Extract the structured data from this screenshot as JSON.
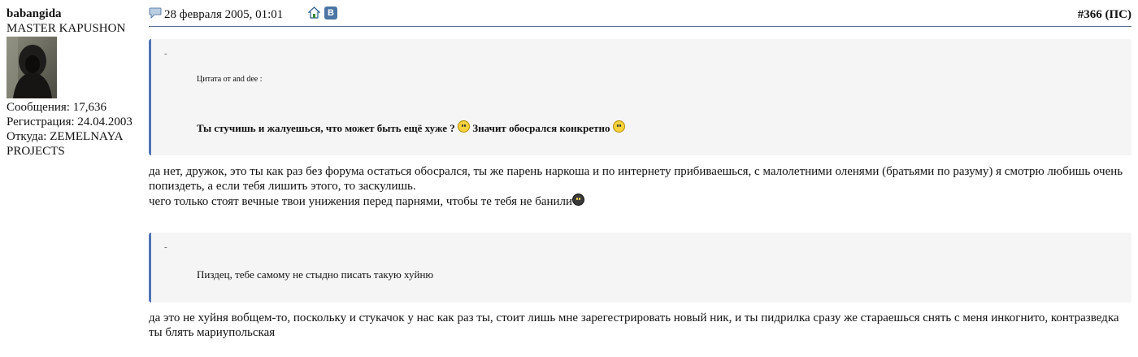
{
  "user": {
    "name": "babangida",
    "rank": "MASTER KAPUSHON",
    "messages": "Сообщения: 17,636",
    "registered": "Регистрация: 24.04.2003",
    "location": "Откуда: ZEMELNAYA PROJECTS"
  },
  "post": {
    "date": "28 февраля 2005, 01:01",
    "vk_label": "В",
    "number": "#366 (ПС)",
    "quote1": {
      "dash": "-",
      "author": "Цитата от and dee :",
      "text_a": "Ты стучишь и жалуешься, что может быть ещё хуже ?",
      "text_b": "Значит обосрался конкретно"
    },
    "reply1_line1": "да нет, дружок, это ты как раз без форума остаться обосрался, ты же парень наркоша и по интернету прибиваешься, с малолетними оленями (братьями по разуму) я смотрю любишь очень попиздеть, а если тебя лишить этого, то заскулишь.",
    "reply1_line2": "чего только стоят вечные твои унижения перед парнями, чтобы те тебя не банили",
    "quote2": {
      "dash": "-",
      "text": "Пиздец, тебе самому не стыдно писать такую хуйню"
    },
    "reply2": "да это не хуйня вобщем-то, поскольку и стукачок у нас как раз ты, стоит лишь мне зарегестрировать новый ник, и ты пидрилка сразу же стараешься снять с меня инкогнито, контразведка ты блять мариупольская"
  },
  "icons": {
    "post_icon": "speech-bubble-icon",
    "home": "home-icon",
    "vk": "vk-icon",
    "smiles": [
      "scared-smiley-icon",
      "grin-smiley-icon",
      "cool-smiley-icon"
    ]
  },
  "colors": {
    "quote_border": "#4f74b6",
    "quote_bg": "#f5f5f5",
    "header_line": "#5d6d8c",
    "vk": "#4c75a3"
  }
}
